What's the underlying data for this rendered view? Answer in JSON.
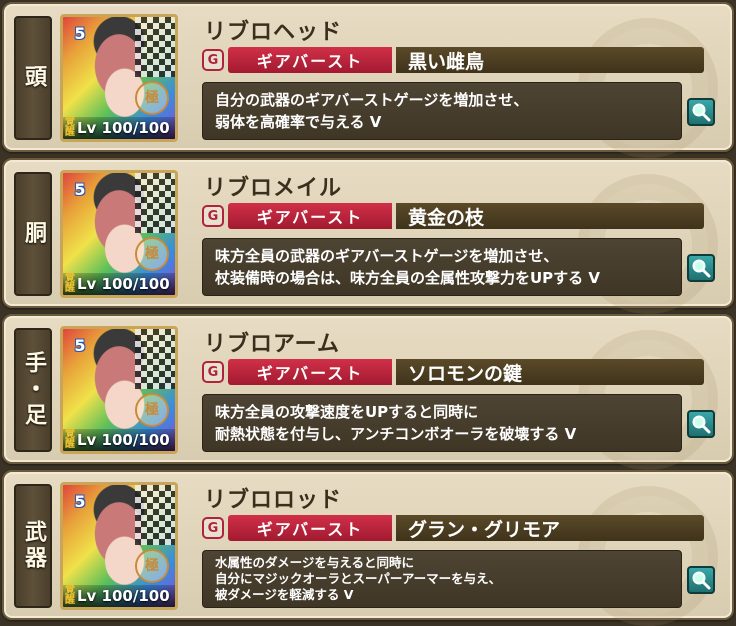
{
  "equipment": [
    {
      "slot": "頭",
      "stars": "5",
      "level": "Lv 100/100",
      "item_name": "リブロヘッド",
      "gear_burst_label": "ギアバースト",
      "gear_burst_name": "黒い雌鳥",
      "description": "自分の武器のギアバーストゲージを増加させ、\n弱体を高確率で与える V"
    },
    {
      "slot": "胴",
      "stars": "5",
      "level": "Lv 100/100",
      "item_name": "リブロメイル",
      "gear_burst_label": "ギアバースト",
      "gear_burst_name": "黄金の枝",
      "description": "味方全員の武器のギアバーストゲージを増加させ、\n杖装備時の場合は、味方全員の全属性攻撃力をUPする V"
    },
    {
      "slot": "手・足",
      "stars": "5",
      "level": "Lv 100/100",
      "item_name": "リブロアーム",
      "gear_burst_label": "ギアバースト",
      "gear_burst_name": "ソロモンの鍵",
      "description": "味方全員の攻撃速度をUPすると同時に\n耐熱状態を付与し、アンチコンボオーラを破壊する V"
    },
    {
      "slot": "武器",
      "stars": "5",
      "level": "Lv 100/100",
      "item_name": "リブロロッド",
      "gear_burst_label": "ギアバースト",
      "gear_burst_name": "グラン・グリモア",
      "description": "水属性のダメージを与えると同時に\n自分にマジックオーラとスーパーアーマーを与え、\n被ダメージを軽減する V"
    }
  ],
  "colors": {
    "gear_burst_red": "#c2283f",
    "name_bar": "#4b3d22",
    "panel": "#e2d6bb",
    "zoom_button": "#2c8b8c"
  },
  "icons": {
    "badge": "gear-burst-icon",
    "zoom": "magnifier-icon"
  }
}
